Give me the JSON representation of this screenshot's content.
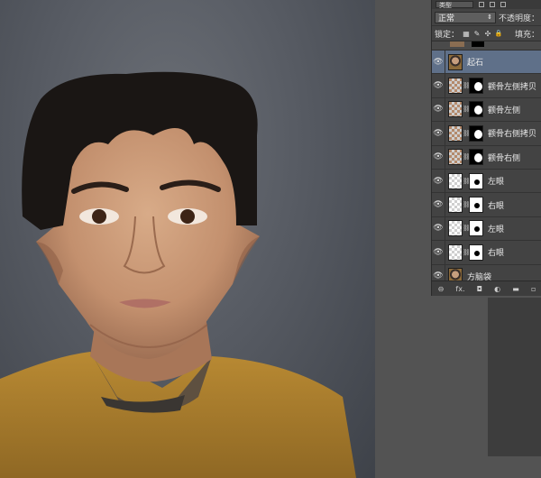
{
  "layers_panel": {
    "blend_mode": "正常",
    "opacity_label": "不透明度：",
    "lock_label": "锁定：",
    "fill_label": "填充：",
    "kind_filter": "类型",
    "layers": [
      {
        "name": "起石",
        "selected": true,
        "thumb": "photo",
        "mask": null
      },
      {
        "name": "颧骨左侧拷贝",
        "selected": false,
        "thumb": "cheek",
        "mask": "black"
      },
      {
        "name": "颧骨左侧",
        "selected": false,
        "thumb": "cheek",
        "mask": "black"
      },
      {
        "name": "颧骨右侧拷贝",
        "selected": false,
        "thumb": "cheek",
        "mask": "black"
      },
      {
        "name": "颧骨右侧",
        "selected": false,
        "thumb": "cheek",
        "mask": "black"
      },
      {
        "name": "左眼",
        "selected": false,
        "thumb": "checker",
        "mask": "white"
      },
      {
        "name": "右眼",
        "selected": false,
        "thumb": "checker",
        "mask": "white"
      },
      {
        "name": "左眼",
        "selected": false,
        "thumb": "checker",
        "mask": "white"
      },
      {
        "name": "右眼",
        "selected": false,
        "thumb": "checker",
        "mask": "white"
      },
      {
        "name": "方脑袋",
        "selected": false,
        "thumb": "photo",
        "mask": null
      }
    ],
    "bottom_icons": [
      "link-icon",
      "fx-icon",
      "mask-icon",
      "adjustment-icon",
      "folder-icon",
      "new-layer-icon"
    ]
  },
  "bottom_labels": {
    "link": "⊖",
    "fx": "fx.",
    "mask": "◘",
    "adjust": "◐",
    "folder": "▬",
    "new": "▫"
  },
  "icons": {
    "eye": "👁",
    "lock_pixels": "▦",
    "lock_paint": "✎",
    "lock_move": "✣",
    "lock_all": "🔒",
    "chain": "⛓",
    "dropdown": "⇕"
  }
}
